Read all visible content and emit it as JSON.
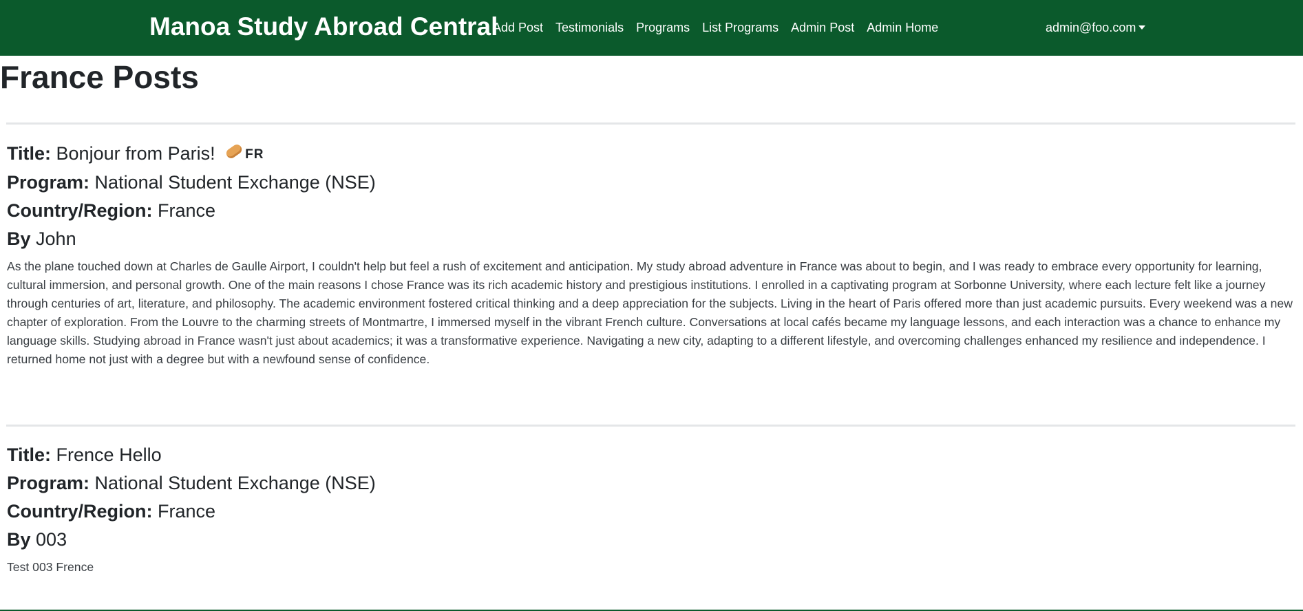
{
  "navbar": {
    "brand": "Manoa Study Abroad Central",
    "links": [
      {
        "label": "Add Post"
      },
      {
        "label": "Testimonials"
      },
      {
        "label": "Programs"
      },
      {
        "label": "List Programs"
      },
      {
        "label": "Admin Post"
      },
      {
        "label": "Admin Home"
      }
    ],
    "user": "admin@foo.com",
    "bg_color": "#0b5a2c"
  },
  "page": {
    "title": "France Posts"
  },
  "labels": {
    "title": "Title:",
    "program": "Program:",
    "country": "Country/Region:",
    "by": "By"
  },
  "posts": [
    {
      "title": "Bonjour from Paris!",
      "flag_icon": "bread-icon",
      "flag_code": "FR",
      "program": "National Student Exchange (NSE)",
      "country": "France",
      "author": "John",
      "body": "As the plane touched down at Charles de Gaulle Airport, I couldn't help but feel a rush of excitement and anticipation. My study abroad adventure in France was about to begin, and I was ready to embrace every opportunity for learning, cultural immersion, and personal growth. One of the main reasons I chose France was its rich academic history and prestigious institutions. I enrolled in a captivating program at Sorbonne University, where each lecture felt like a journey through centuries of art, literature, and philosophy. The academic environment fostered critical thinking and a deep appreciation for the subjects. Living in the heart of Paris offered more than just academic pursuits. Every weekend was a new chapter of exploration. From the Louvre to the charming streets of Montmartre, I immersed myself in the vibrant French culture. Conversations at local cafés became my language lessons, and each interaction was a chance to enhance my language skills. Studying abroad in France wasn't just about academics; it was a transformative experience. Navigating a new city, adapting to a different lifestyle, and overcoming challenges enhanced my resilience and independence. I returned home not just with a degree but with a newfound sense of confidence."
    },
    {
      "title": "Frence Hello",
      "program": "National Student Exchange (NSE)",
      "country": "France",
      "author": "003",
      "body": "Test 003 Frence"
    }
  ]
}
